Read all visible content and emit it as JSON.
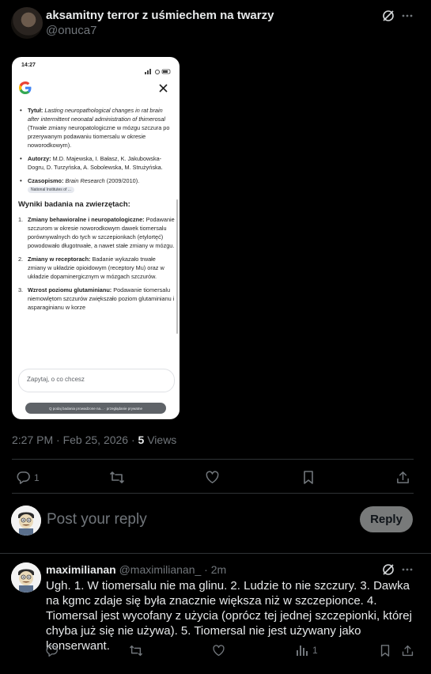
{
  "post": {
    "author_name": "aksamitny terror z uśmiechem na twarzy",
    "author_handle": "@onuca7",
    "timestamp": "2:27 PM · Feb 25, 2026 · ",
    "views_count": "5",
    "views_label": " Views",
    "actions": {
      "reply_count": "1",
      "retweet_count": "",
      "like_count": ""
    }
  },
  "screenshot": {
    "status_time": "14:27",
    "items": [
      {
        "label": "Tytuł:",
        "italic": "Lasting neuropathological changes in rat brain after intermittent neonatal administration of thimerosal",
        "rest": " (Trwałe zmiany neuropatologiczne w mózgu szczura po przerywanym podawaniu tiomersalu w okresie noworodkowym)."
      },
      {
        "label": "Autorzy:",
        "italic": "",
        "rest": " M.D. Majewska, I. Bałasz, K. Jakubowska-Dogru, D. Turzyńska, A. Sobolewska, M. Strużyńska."
      },
      {
        "label": "Czasopismo:",
        "italic": "Brain Research",
        "rest": " (2009/2010).",
        "chip": "National Institutes of ..."
      }
    ],
    "section_title": "Wyniki badania na zwierzętach:",
    "results": [
      {
        "num": "1.",
        "label": "Zmiany behawioralne i neuropatologiczne:",
        "text": " Podawanie szczurom w okresie noworodkowym dawek tiomersalu porównywalnych do tych w szczepionkach (etylortęć) powodowało długotrwałe, a nawet stałe zmiany w mózgu."
      },
      {
        "num": "2.",
        "label": "Zmiany w receptorach:",
        "text": " Badanie wykazało trwałe zmiany w układzie opioidowym (receptory Mu) oraz w układzie dopaminergicznym w mózgach szczurów."
      },
      {
        "num": "3.",
        "label": "Wzrost poziomu glutaminianu:",
        "text": " Podawanie tiomersalu niemowlętom szczurów zwiększało poziom glutaminianu i asparaginianu w korze"
      }
    ],
    "ask_placeholder": "Zapytaj, o co chcesz",
    "bottom_pill": "Q podaj badania prowadzone na... · przeglądanie prywatne"
  },
  "compose": {
    "placeholder": "Post your reply",
    "button": "Reply"
  },
  "reply": {
    "author_name": "maximilianan",
    "author_handle": "@maximilianan_",
    "time": " · 2m",
    "text": "Ugh. 1. W tiomersalu nie ma glinu. 2. Ludzie to nie szczury. 3. Dawka na kgmc zdaje się była znacznie większa niż w szczepionce. 4. Tiomersal jest wycofany z użycia (oprócz tej jednej szczepionki, której chyba już się nie używa). 5. Tiomersal nie jest używany jako konserwant.",
    "views_count": "1"
  },
  "icons": [
    "grok-icon",
    "more-icon",
    "reply-icon",
    "retweet-icon",
    "like-icon",
    "bookmark-icon",
    "share-icon",
    "views-icon",
    "google-logo",
    "close-icon"
  ]
}
